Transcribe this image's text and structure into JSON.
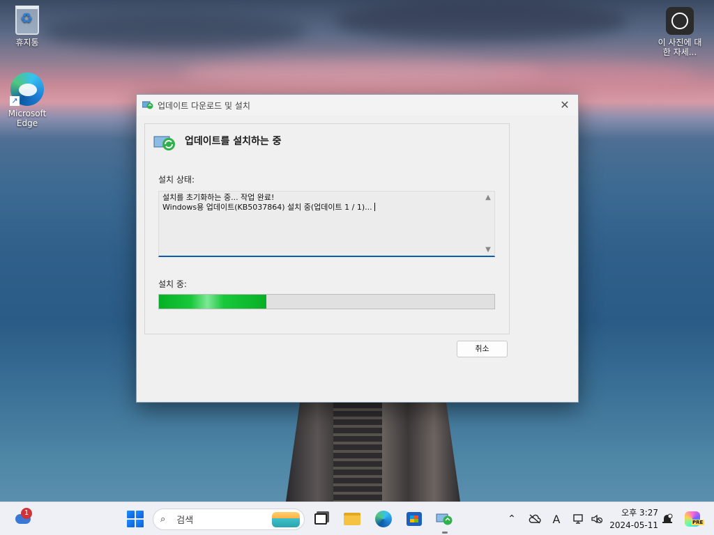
{
  "desktop": {
    "icons": [
      {
        "label": "휴지통",
        "icon": "recycle-bin-icon"
      },
      {
        "label": "Microsoft Edge",
        "icon": "edge-icon"
      },
      {
        "label": "이 사진에 대한 자세...",
        "icon": "photo-info-icon"
      }
    ]
  },
  "dialog": {
    "title": "업데이트 다운로드 및 설치",
    "heading": "업데이트를 설치하는 중",
    "status_label": "설치 상태:",
    "status_lines": [
      "설치를 초기화하는 중... 작업 완료!",
      "Windows용 업데이트(KB5037864) 설치 중(업데이트 1 / 1)..."
    ],
    "progress_label": "설치 중:",
    "progress_fraction": 0.32,
    "cancel_label": "취소",
    "close_icon": "close-icon"
  },
  "taskbar": {
    "weather_badge": "1",
    "search_placeholder": "검색",
    "ime_indicator": "A",
    "clock_time": "오후 3:27",
    "clock_date": "2024-05-11",
    "copilot_badge": "PRE"
  },
  "colors": {
    "progress": "#06b025",
    "accent": "#0b5cab"
  }
}
